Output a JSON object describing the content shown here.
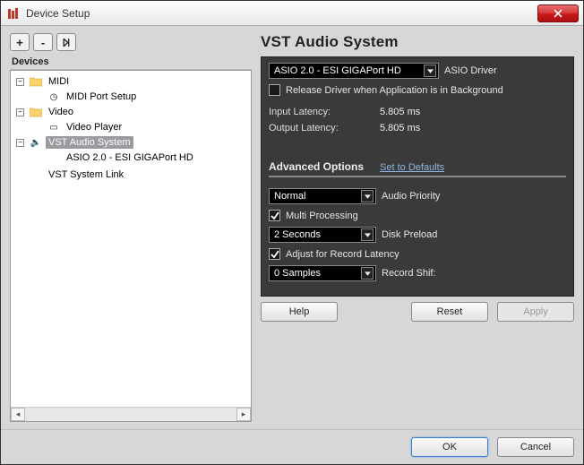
{
  "window": {
    "title": "Device Setup"
  },
  "toolbar": {
    "add_tip": "+",
    "remove_tip": "-"
  },
  "tree": {
    "header": "Devices",
    "midi": {
      "label": "MIDI",
      "port_setup": "MIDI Port Setup"
    },
    "video": {
      "label": "Video",
      "player": "Video Player"
    },
    "vst": {
      "label": "VST Audio System",
      "asio": "ASIO 2.0 - ESI GIGAPort HD"
    },
    "vst_link": "VST System Link"
  },
  "panel": {
    "title": "VST Audio System",
    "asio_select": "ASIO 2.0 - ESI GIGAPort HD",
    "asio_driver_label": "ASIO Driver",
    "release_driver": "Release Driver when Application is in Background",
    "release_driver_checked": false,
    "input_latency_label": "Input Latency:",
    "input_latency_value": "5.805 ms",
    "output_latency_label": "Output Latency:",
    "output_latency_value": "5.805 ms",
    "advanced_title": "Advanced Options",
    "set_defaults": "Set to Defaults",
    "audio_priority_value": "Normal",
    "audio_priority_label": "Audio Priority",
    "multi_processing": "Multi Processing",
    "multi_processing_checked": true,
    "disk_preload_value": "2 Seconds",
    "disk_preload_label": "Disk Preload",
    "adjust_record": "Adjust for Record Latency",
    "adjust_record_checked": true,
    "record_shift_value": "0 Samples",
    "record_shift_label": "Record Shif:"
  },
  "buttons": {
    "help": "Help",
    "reset": "Reset",
    "apply": "Apply",
    "ok": "OK",
    "cancel": "Cancel"
  }
}
